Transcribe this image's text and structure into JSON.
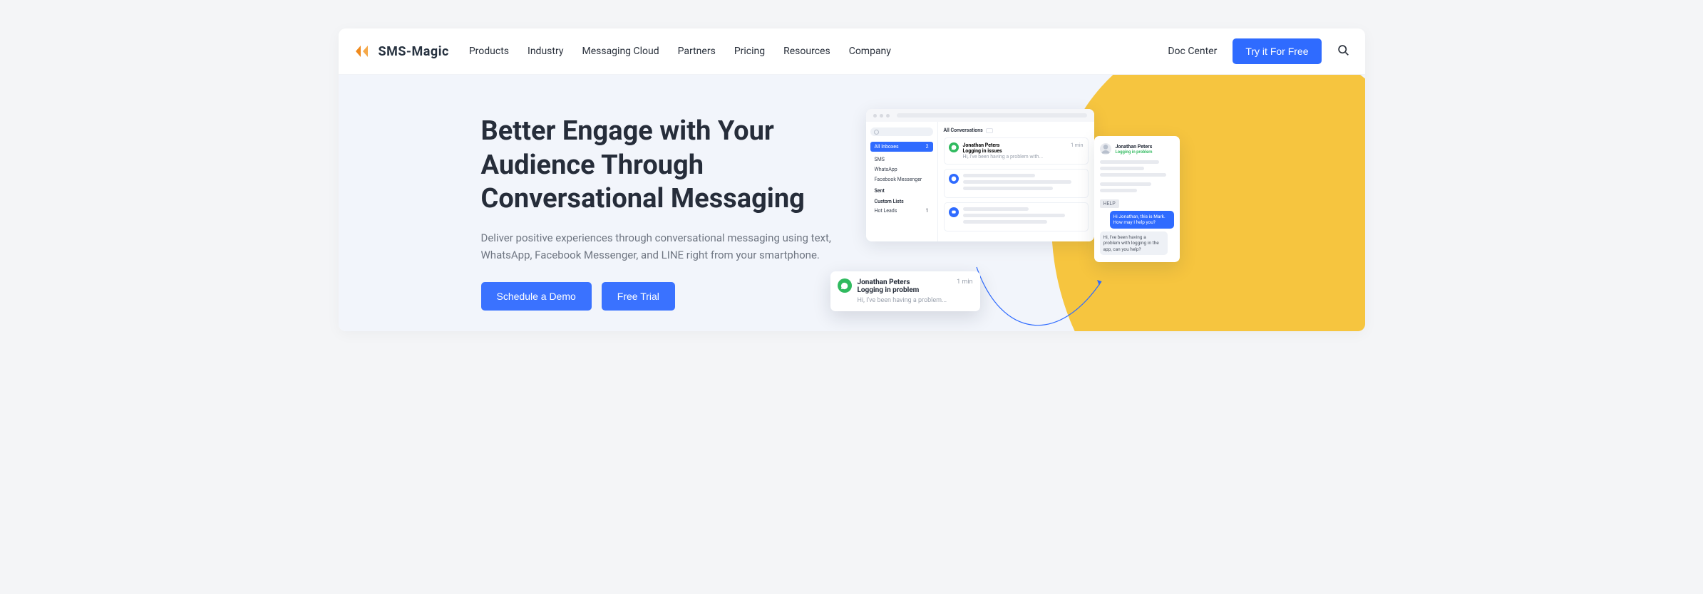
{
  "brand": {
    "name": "SMS-Magic"
  },
  "nav": {
    "links": [
      "Products",
      "Industry",
      "Messaging Cloud",
      "Partners",
      "Pricing",
      "Resources",
      "Company"
    ],
    "doc_center": "Doc Center",
    "cta": "Try it For Free"
  },
  "hero": {
    "title": "Better Engage with Your Audience Through Conversational Messaging",
    "subtitle": "Deliver positive experiences through conversational messaging using text, WhatsApp, Facebook Messenger, and LINE right from your smartphone.",
    "schedule_label": "Schedule a Demo",
    "trial_label": "Free Trial"
  },
  "mock": {
    "sidebar": {
      "all_inboxes": {
        "label": "All Inboxes",
        "count": "2"
      },
      "items": [
        "SMS",
        "WhatsApp",
        "Facebook Messenger"
      ],
      "sent_label": "Sent",
      "custom_label": "Custom Lists",
      "hot_leads": {
        "label": "Hot Leads",
        "count": "1"
      }
    },
    "conversations": {
      "header": "All Conversations",
      "first": {
        "name": "Jonathan Peters",
        "subject": "Logging in issues",
        "preview": "Hi, I've been having a problem with...",
        "time": "1 min"
      }
    },
    "floating": {
      "name": "Jonathan Peters",
      "subject": "Logging in problem",
      "preview": "Hi, I've been having a problem...",
      "time": "1 min"
    },
    "detail": {
      "name": "Jonathan Peters",
      "status": "Logging in problem",
      "help_chip": "HELP",
      "agent_msg": "Hi Jonathan, this is Mark. How may I help you?",
      "user_msg": "Hi, I've been having a problem with logging in the app, can you help?"
    }
  }
}
